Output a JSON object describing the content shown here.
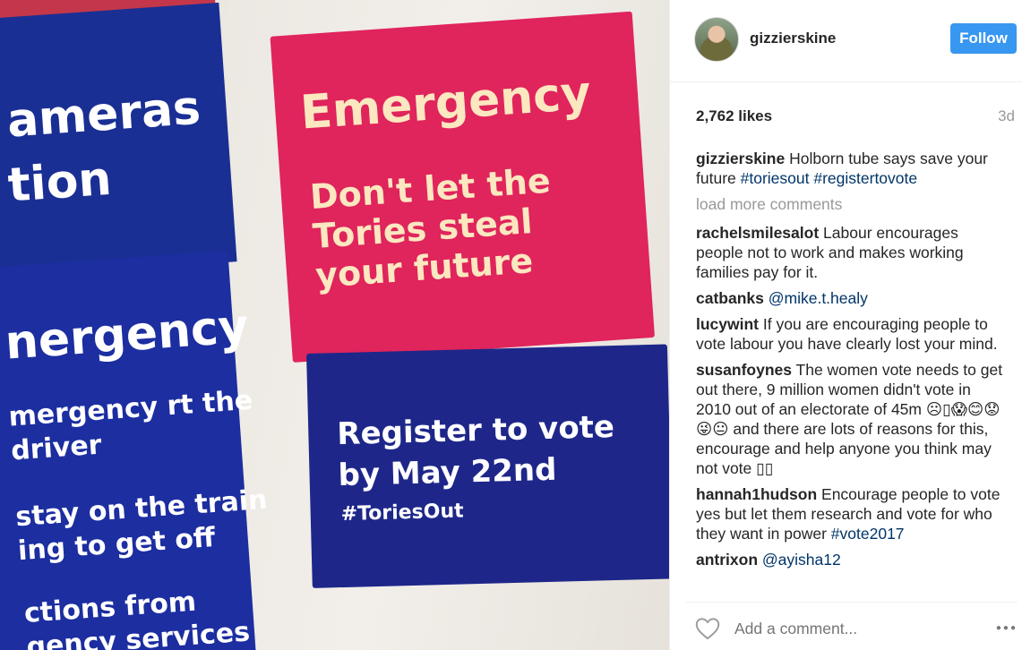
{
  "photo": {
    "pink_panel": {
      "heading": "Emergency",
      "body": "Don't let the Tories steal your future"
    },
    "navy_panel": {
      "body": "Register to vote by May 22nd",
      "hashtag": "#ToriesOut"
    },
    "left_panels": {
      "top_line1": "ameras",
      "top_line2": "tion",
      "heading": "nergency",
      "line1": "mergency rt the driver",
      "line2": "stay on the train ing to get off",
      "line3": "ctions from gency services"
    }
  },
  "post": {
    "username": "gizzierskine",
    "follow_label": "Follow",
    "likes": "2,762 likes",
    "age": "3d",
    "caption": {
      "user": "gizzierskine",
      "text": "Holborn tube says save your future",
      "tags": [
        "#toriesout",
        "#registertovote"
      ]
    },
    "load_more": "load more comments",
    "comments": [
      {
        "user": "rachelsmilesalot",
        "text": "Labour encourages people not to work and makes working families pay for it."
      },
      {
        "user": "catbanks",
        "mention": "@mike.t.healy"
      },
      {
        "user": "lucywint",
        "text": "If you are encouraging people to vote labour you have clearly lost your mind."
      },
      {
        "user": "susanfoynes",
        "text": "The women vote needs to get out there, 9 million women didn't vote in 2010 out of an electorate of 45m ☹▯😱😊😟😜😐 and there are lots of reasons for this, encourage and help anyone you think may not vote ▯▯"
      },
      {
        "user": "hannah1hudson",
        "text": "Encourage people to vote yes but let them research and vote for who they want in power",
        "tag": "#vote2017"
      },
      {
        "user": "antrixon",
        "mention": "@ayisha12"
      }
    ],
    "add_comment_placeholder": "Add a comment...",
    "more_icon": "more-options-icon",
    "like_icon": "heart-icon"
  },
  "colors": {
    "follow_button": "#3897f0",
    "pink_panel": "#e0245c",
    "navy_panel": "#1e2789",
    "tag": "#003569"
  }
}
